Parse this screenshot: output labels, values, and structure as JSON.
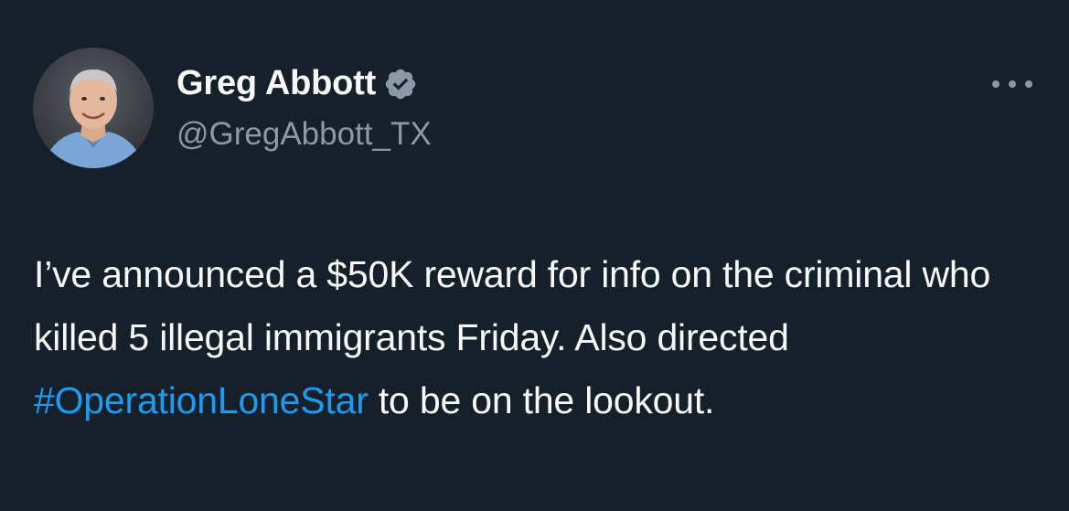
{
  "author": {
    "display_name": "Greg Abbott",
    "handle": "@GregAbbott_TX",
    "verified": true,
    "avatar_icon": "profile-photo"
  },
  "tweet": {
    "text_before_hashtag": "I’ve announced a $50K reward for info on the criminal who killed 5 illegal immigrants Friday. Also directed ",
    "hashtag": "#OperationLoneStar",
    "text_after_hashtag": " to be on the lookout."
  },
  "actions": {
    "more_icon": "more-horizontal-icon"
  },
  "colors": {
    "background": "#15202b",
    "text": "#f7f9f9",
    "secondary_text": "#8b98a5",
    "link": "#1d9bf0",
    "verified_badge": "#8b98a5"
  }
}
